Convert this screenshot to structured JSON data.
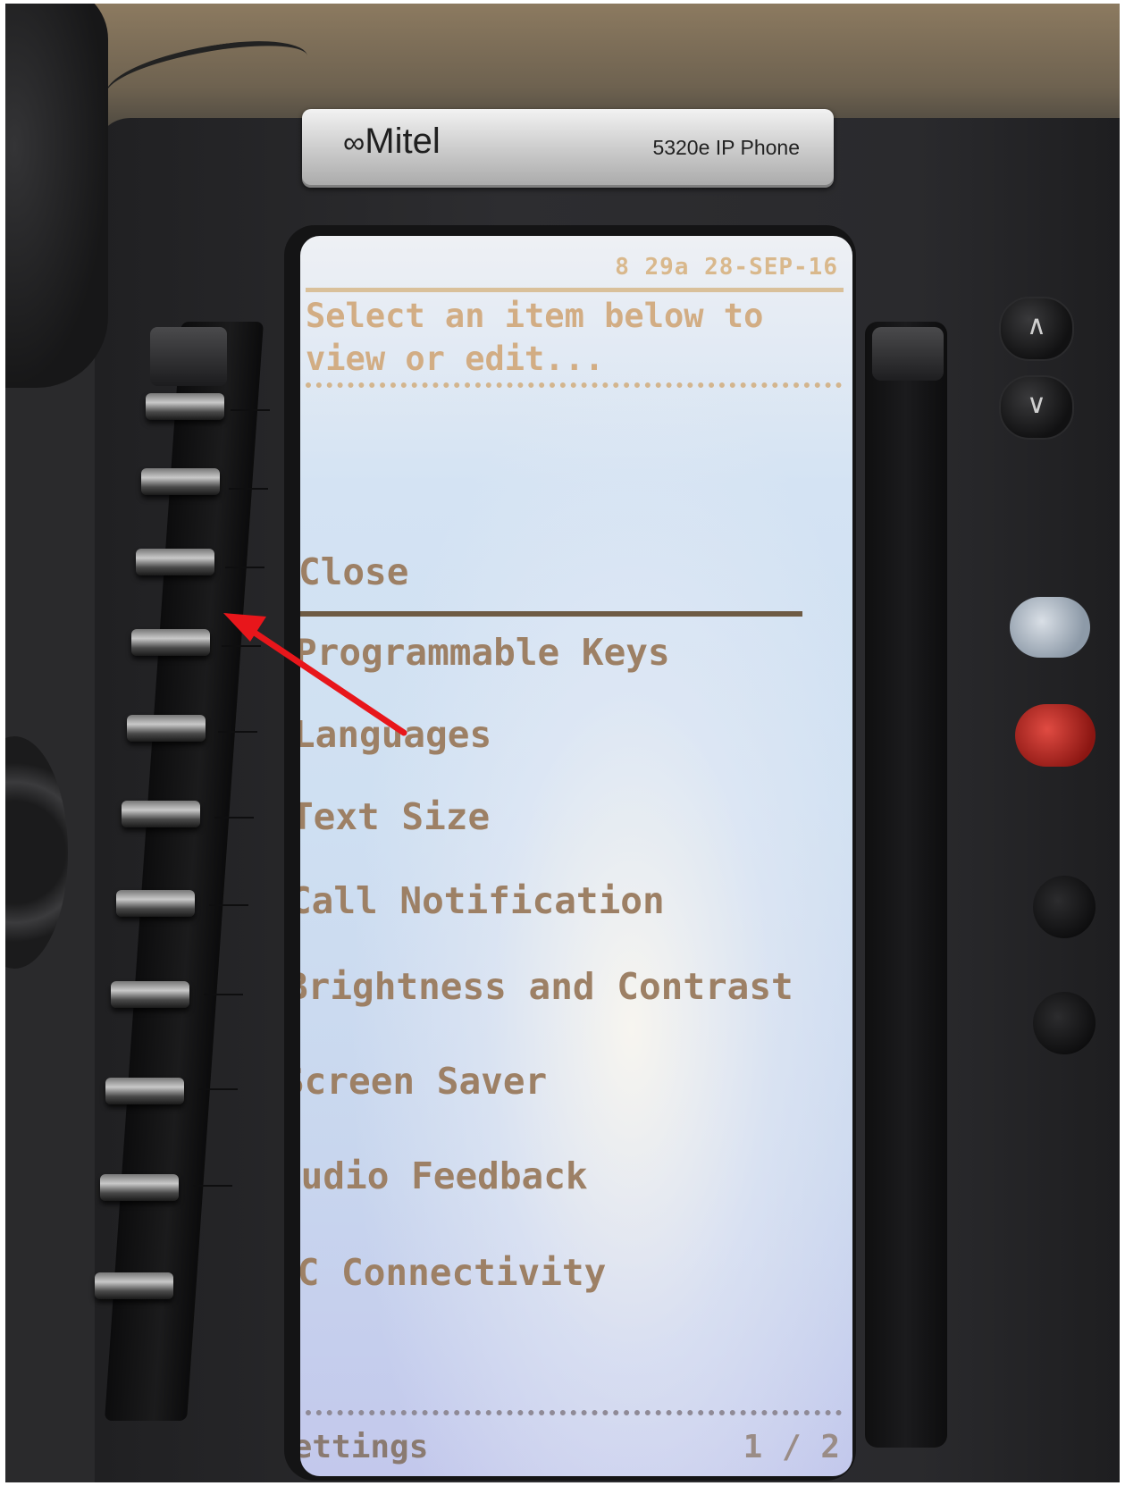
{
  "device": {
    "brand": "Mitel",
    "model": "5320e IP Phone"
  },
  "screen": {
    "clock": "8 29a 28-SEP-16",
    "prompt": "Select an item below to\nview or edit...",
    "items": [
      "Close",
      "Programmable Keys",
      "Languages",
      "Text Size",
      "Call Notification",
      "Brightness and Contrast",
      "Screen Saver",
      "Audio Feedback",
      "PC Connectivity"
    ],
    "footer_title": "Settings",
    "page": "1 / 2"
  },
  "colors": {
    "screen_text": "#9d8065",
    "arrow": "#e8161b"
  },
  "annotation": {
    "type": "arrow",
    "points_to": "programmable-key-3"
  }
}
